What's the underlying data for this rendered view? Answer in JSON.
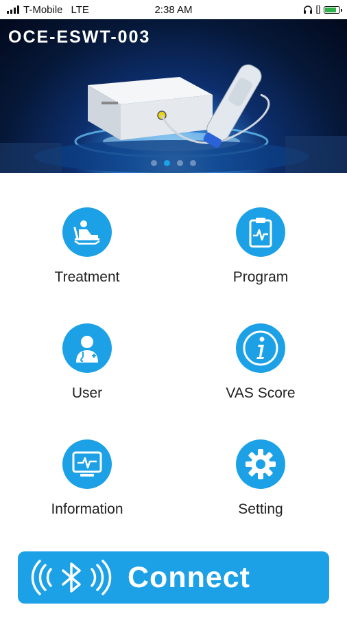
{
  "status": {
    "carrier": "T-Mobile",
    "network": "LTE",
    "time": "2:38 AM",
    "battery_level": 0.8
  },
  "banner": {
    "title": "OCE-ESWT-003",
    "slide_count": 4,
    "active_slide": 2
  },
  "menu": {
    "treatment": "Treatment",
    "program": "Program",
    "user": "User",
    "vas": "VAS Score",
    "information": "Information",
    "setting": "Setting"
  },
  "connect": {
    "label": "Connect"
  },
  "colors": {
    "accent": "#1da1e6"
  }
}
